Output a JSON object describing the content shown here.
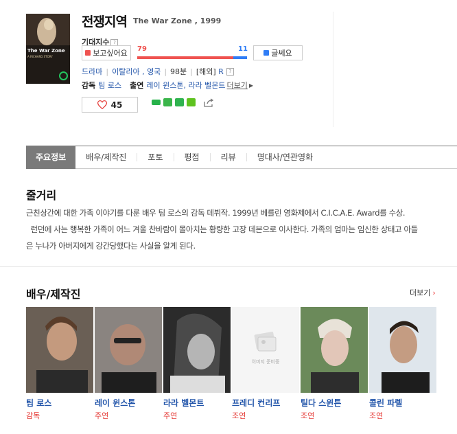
{
  "movie": {
    "title": "전쟁지역",
    "subtitle": "The War Zone , 1999",
    "poster_title": "The War Zone",
    "poster_sub": "A  RICHARD  STORY"
  },
  "expectation": {
    "label": "기대지수",
    "want_label": "보고싶어요",
    "dont_label": "글쎄요",
    "want_count": "79",
    "dont_count": "11",
    "want_fraction": 0.878
  },
  "meta": {
    "genre": "드라마",
    "country": "이탈리아 , 영국",
    "runtime": "98분",
    "rating_prefix": "[해외]",
    "rating": "R"
  },
  "crew": {
    "director_label": "감독",
    "director": "팀 로스",
    "cast_label": "출연",
    "cast": "레이 윈스톤, 라라 벨몬트",
    "more": "더보기"
  },
  "likes": {
    "count": "45"
  },
  "tabs": [
    "주요정보",
    "배우/제작진",
    "포토",
    "평점",
    "리뷰",
    "명대사/연관영화"
  ],
  "synopsis": {
    "heading": "줄거리",
    "line1": "근친상간에 대한 가족 이야기를 다룬 배우 팀 로스의 감독 데뷔작. 1999년 베를린 영화제에서 C.I.C.A.E. Award를 수상.",
    "line2": "  런던에 사는 행복한 가족이 어느 겨울 찬바람이 몰아치는 황량한 고장 데본으로 이사한다. 가족의 엄마는 임신한 상태고 아들",
    "line3": "은 누나가 아버지에게 강간당했다는 사실을 알게 된다."
  },
  "cast_section": {
    "heading": "배우/제작진",
    "more": "더보기",
    "placeholder_text": "이미지 준비중",
    "people": [
      {
        "name": "팀 로스",
        "role": "감독"
      },
      {
        "name": "레이 윈스톤",
        "role": "주연"
      },
      {
        "name": "라라 벨몬트",
        "role": "주연"
      },
      {
        "name": "프레디 컨리프",
        "role": "조연"
      },
      {
        "name": "틸다 스윈튼",
        "role": "조연"
      },
      {
        "name": "콜린 파렐",
        "role": "조연"
      }
    ]
  }
}
